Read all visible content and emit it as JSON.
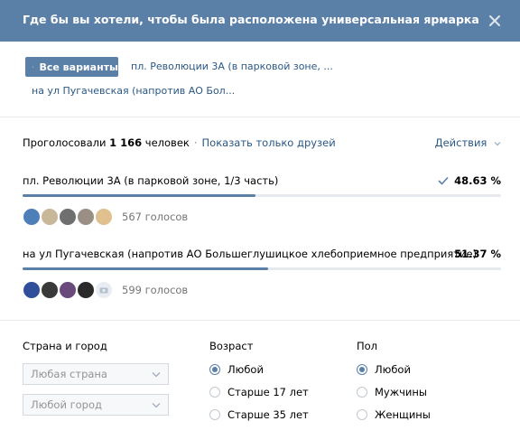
{
  "header": {
    "title": "Где бы вы хотели, чтобы была расположена универсальная ярмарка"
  },
  "tabs": {
    "all_label": "Все варианты",
    "option1_short": "пл. Революции 3А (в парковой зоне, ...",
    "option2_short": "на ул Пугачевская (напротив АО Бол..."
  },
  "summary": {
    "voted_label": "Проголосовали",
    "voted_count": "1 166",
    "voted_unit": "человек",
    "separator": "·",
    "friends_link": "Показать только друзей",
    "actions_label": "Действия"
  },
  "options": [
    {
      "text": "пл. Революции 3А (в парковой зоне, 1/3 часть)",
      "percent": "48.63 %",
      "fraction": 0.4863,
      "checked": true,
      "votes": "567 голосов"
    },
    {
      "text": "на ул Пугачевская (напротив АО Большеглушицкое хлебоприемное предприятие)",
      "percent": "51.37 %",
      "fraction": 0.5137,
      "checked": false,
      "votes": "599 голосов"
    }
  ],
  "filters": {
    "location": {
      "title": "Страна и город",
      "country_placeholder": "Любая страна",
      "city_placeholder": "Любой город"
    },
    "age": {
      "title": "Возраст",
      "options": [
        "Любой",
        "Старше 17 лет",
        "Старше 35 лет"
      ],
      "selected": 0
    },
    "gender": {
      "title": "Пол",
      "options": [
        "Любой",
        "Мужчины",
        "Женщины"
      ],
      "selected": 0
    }
  },
  "colors": {
    "header_bg": "#5b80a8",
    "accent": "#5b80a8",
    "link": "#2a5885"
  }
}
